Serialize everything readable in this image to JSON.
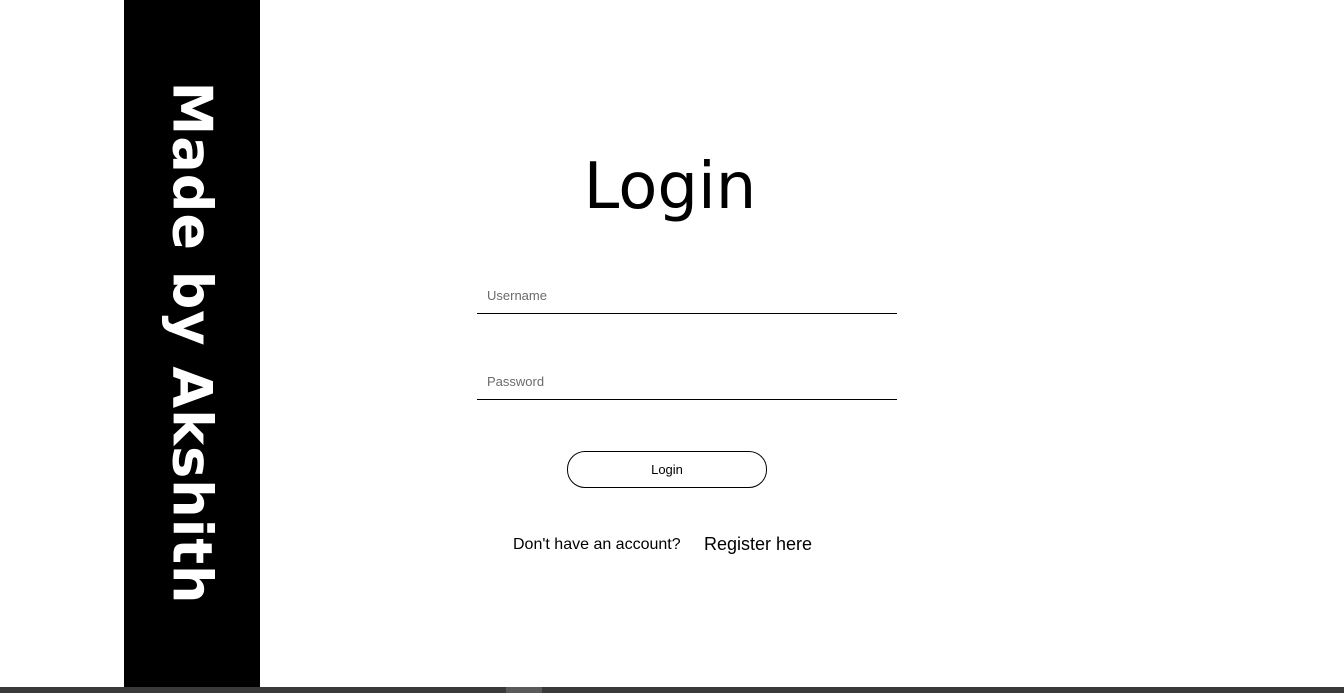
{
  "side_banner": {
    "text": "Made by Akshith",
    "background_color": "#000000",
    "text_color": "#ffffff"
  },
  "login_form": {
    "title": "Login",
    "username": {
      "placeholder": "Username",
      "value": ""
    },
    "password": {
      "placeholder": "Password",
      "value": ""
    },
    "submit_label": "Login"
  },
  "register": {
    "prompt": "Don't have an account?",
    "link_label": "Register here"
  }
}
